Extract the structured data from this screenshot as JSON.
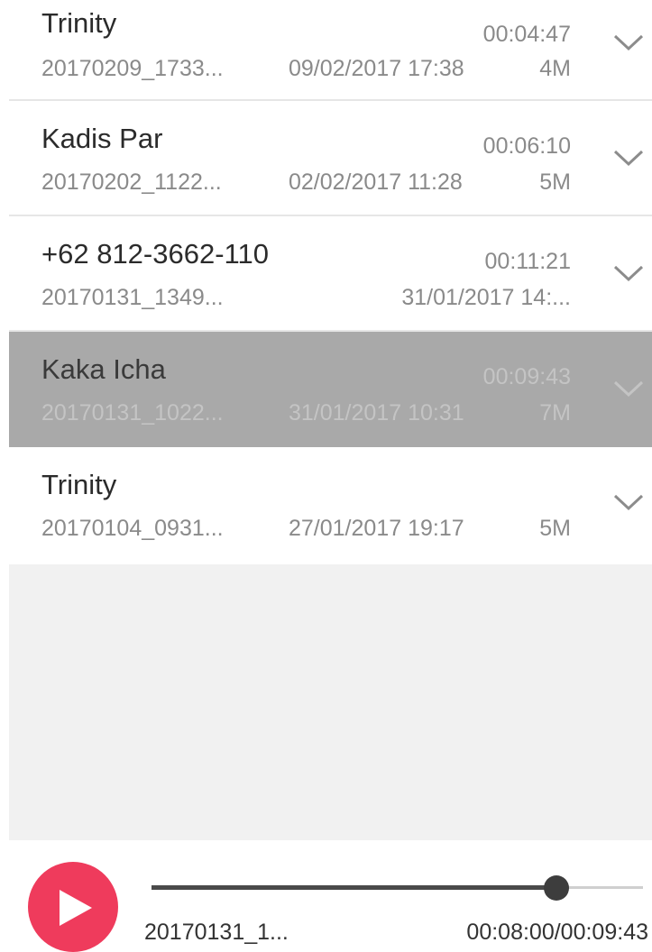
{
  "recordings": [
    {
      "name": "Trinity",
      "duration": "00:04:47",
      "filename": "20170209_1733...",
      "date": "09/02/2017 17:38",
      "size": "4M",
      "icon": "chevron-down-icon"
    },
    {
      "name": "Kadis Par",
      "duration": "00:06:10",
      "filename": "20170202_1122...",
      "date": "02/02/2017 11:28",
      "size": "5M",
      "icon": "chevron-down-icon"
    },
    {
      "name": "+62 812-3662-110",
      "duration": "00:11:21",
      "filename": "20170131_1349...",
      "date": "31/01/2017 14:...",
      "size": "",
      "icon": "chevron-down-icon"
    },
    {
      "name": "Kaka Icha",
      "duration": "00:09:43",
      "filename": "20170131_1022...",
      "date": "31/01/2017 10:31",
      "size": "7M",
      "selected": true,
      "icon": "chevron-down-icon"
    },
    {
      "name": "Trinity",
      "duration": "",
      "filename": "20170104_0931...",
      "date": "27/01/2017 19:17",
      "size": "5M",
      "icon": "chevron-down-icon"
    }
  ],
  "player": {
    "filename": "20170131_1...",
    "time": "00:08:00/00:09:43",
    "progress": 0.823,
    "play_icon": "play-icon",
    "accent_color": "#ef3b5c"
  },
  "colors": {
    "selected_row": "#a9a9a9",
    "empty_area": "#f1f1f1"
  }
}
